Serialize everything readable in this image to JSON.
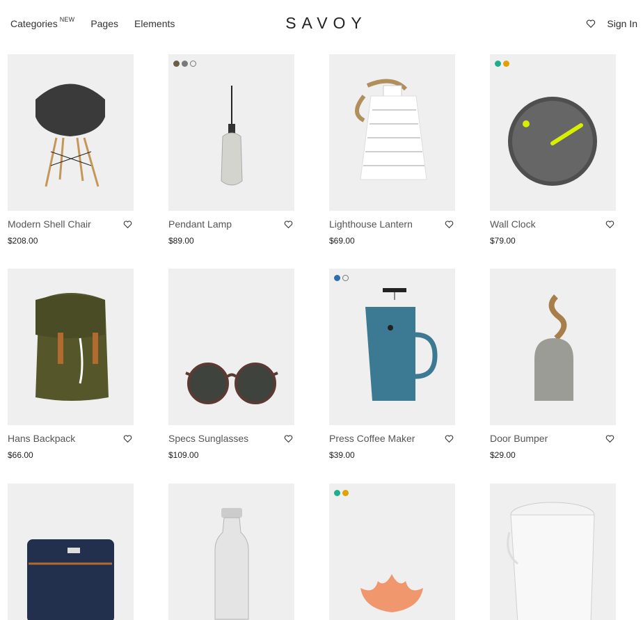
{
  "header": {
    "nav": [
      {
        "label": "Categories",
        "badge": "NEW"
      },
      {
        "label": "Pages"
      },
      {
        "label": "Elements"
      }
    ],
    "logo": "SAVOY",
    "sign_in": "Sign In"
  },
  "products": [
    {
      "title": "Modern Shell Chair",
      "price": "$208.00",
      "swatches": []
    },
    {
      "title": "Pendant Lamp",
      "price": "$89.00",
      "swatches": [
        "#6b5e45",
        "#7a7a7a",
        "#ffffff"
      ]
    },
    {
      "title": "Lighthouse Lantern",
      "price": "$69.00",
      "swatches": []
    },
    {
      "title": "Wall Clock",
      "price": "$79.00",
      "swatches": [
        "#1fae8e",
        "#e2a100"
      ]
    },
    {
      "title": "Hans Backpack",
      "price": "$66.00",
      "swatches": []
    },
    {
      "title": "Specs Sunglasses",
      "price": "$109.00",
      "swatches": []
    },
    {
      "title": "Press Coffee Maker",
      "price": "$39.00",
      "swatches": [
        "#2f6db1",
        "#ffffff"
      ]
    },
    {
      "title": "Door Bumper",
      "price": "$29.00",
      "swatches": []
    },
    {
      "title": "",
      "price": "",
      "swatches": []
    },
    {
      "title": "",
      "price": "",
      "swatches": []
    },
    {
      "title": "",
      "price": "",
      "swatches": [
        "#1fae8e",
        "#e2a100"
      ]
    },
    {
      "title": "",
      "price": "",
      "swatches": []
    }
  ]
}
